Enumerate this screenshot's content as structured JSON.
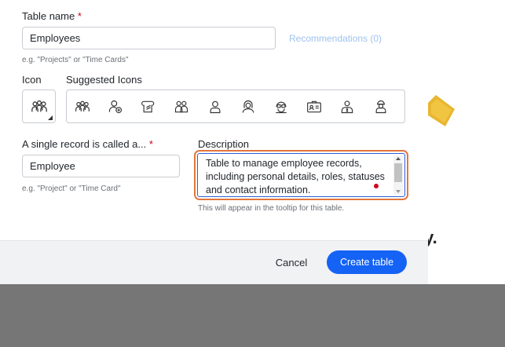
{
  "form": {
    "table_name_label": "Table name",
    "required_mark": "*",
    "table_name_value": "Employees",
    "recommendations_link": "Recommendations (0)",
    "table_name_hint": "e.g. \"Projects\" or \"Time Cards\"",
    "icon_label": "Icon",
    "suggested_icons_label": "Suggested Icons",
    "record_label": "A single record is called a...",
    "record_value": "Employee",
    "record_hint": "e.g. \"Project\" or \"Time Card\"",
    "description_label": "Description",
    "description_value": "Table to manage employee records, including personal details, roles, statuses and contact information.",
    "description_hint": "This will appear in the tooltip for this table."
  },
  "footer": {
    "cancel_label": "Cancel",
    "create_label": "Create table"
  },
  "background": {
    "partial_text": "y."
  },
  "icons": {
    "current": "people-group-icon",
    "suggested": [
      "people-group-icon",
      "user-add-icon",
      "card-icon",
      "users-icon",
      "user-icon",
      "user-female-icon",
      "user-glasses-icon",
      "id-card-icon",
      "user-money-icon",
      "user-cap-icon"
    ]
  },
  "colors": {
    "primary": "#1463f5",
    "focus_ring": "#e2763d",
    "required": "#d0021b",
    "link": "#9ec2ee"
  }
}
